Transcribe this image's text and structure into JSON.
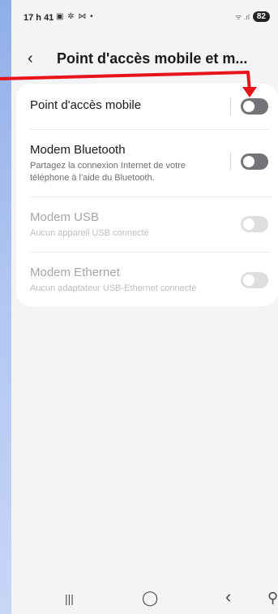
{
  "status_bar": {
    "time": "17 h 41",
    "icons": "▣ ✲ ⋈ •",
    "signal": "ᯤ .ıl",
    "battery": "82"
  },
  "header": {
    "back_icon": "‹",
    "title": "Point d'accès mobile et m..."
  },
  "settings": {
    "items": [
      {
        "title": "Point d'accès mobile",
        "subtitle": "",
        "enabled": true,
        "on": false
      },
      {
        "title": "Modem Bluetooth",
        "subtitle": "Partagez la connexion Internet de votre téléphone à l'aide du Bluetooth.",
        "enabled": true,
        "on": false
      },
      {
        "title": "Modem USB",
        "subtitle": "Aucun appareil USB connecté",
        "enabled": false,
        "on": false
      },
      {
        "title": "Modem Ethernet",
        "subtitle": "Aucun adaptateur USB-Ethernet connecté",
        "enabled": false,
        "on": false
      }
    ]
  },
  "nav": {
    "recent": "|||",
    "home": "◯",
    "back": "‹",
    "accessibility": "⚲"
  },
  "colors": {
    "annotation_red": "#e8141b",
    "toggle_off": "#737478",
    "toggle_disabled": "#dedede"
  }
}
